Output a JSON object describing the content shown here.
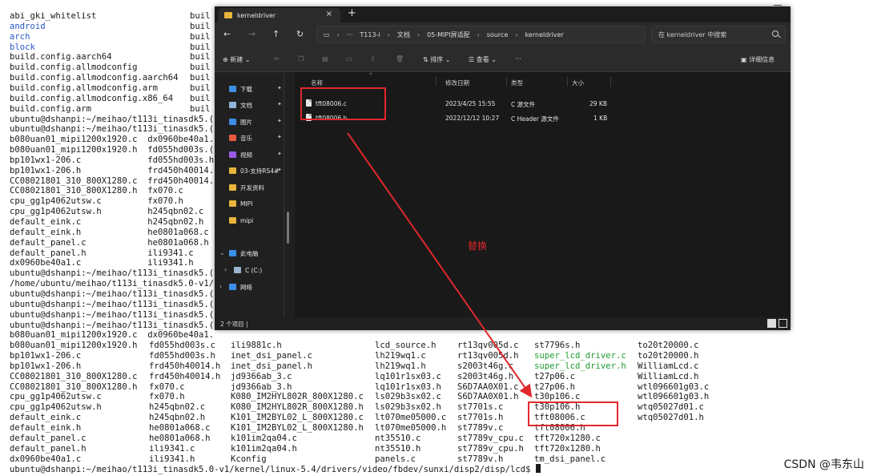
{
  "terminal": {
    "left_block": [
      {
        "c1": "abi_gki_whitelist",
        "c2": "buil",
        "cls": ""
      },
      {
        "c1": "android",
        "c2": "buil",
        "cls": "t-blue"
      },
      {
        "c1": "arch",
        "c2": "buil",
        "cls": "t-blue"
      },
      {
        "c1": "block",
        "c2": "buil",
        "cls": "t-blue"
      },
      {
        "c1": "build.config.aarch64",
        "c2": "buil",
        "cls": ""
      },
      {
        "c1": "build.config.allmodconfig",
        "c2": "buil",
        "cls": ""
      },
      {
        "c1": "build.config.allmodconfig.aarch64",
        "c2": "buil",
        "cls": ""
      },
      {
        "c1": "build.config.allmodconfig.arm",
        "c2": "buil",
        "cls": ""
      },
      {
        "c1": "build.config.allmodconfig.x86_64",
        "c2": "buil",
        "cls": ""
      },
      {
        "c1": "build.config.arm",
        "c2": "buil",
        "cls": ""
      },
      {
        "c1": "ubuntu@dshanpi:~/meihao/t113i_tinasdk5.(",
        "c2": "",
        "cls": ""
      },
      {
        "c1": "ubuntu@dshanpi:~/meihao/t113i_tinasdk5.(",
        "c2": "",
        "cls": ""
      },
      {
        "c1": "b080uan01_mipi1200x1920.c  dx0960be40a1.",
        "c2": "",
        "cls": ""
      },
      {
        "c1": "b080uan01_mipi1200x1920.h  fd055hd003s.(",
        "c2": "",
        "cls": ""
      },
      {
        "c1": "bp101wx1-206.c             fd055hd003s.h",
        "c2": "",
        "cls": ""
      },
      {
        "c1": "bp101wx1-206.h             frd450h40014.",
        "c2": "",
        "cls": ""
      },
      {
        "c1": "CC08021801_310_800X1280.c  frd450h40014.",
        "c2": "",
        "cls": ""
      },
      {
        "c1": "CC08021801_310_800X1280.h  fx070.c",
        "c2": "",
        "cls": ""
      },
      {
        "c1": "cpu_gg1p4062utsw.c         fx070.h",
        "c2": "",
        "cls": ""
      },
      {
        "c1": "cpu_gg1p4062utsw.h         h245qbn02.c",
        "c2": "",
        "cls": ""
      },
      {
        "c1": "default_eink.c             h245qbn02.h",
        "c2": "",
        "cls": ""
      },
      {
        "c1": "default_eink.h             he0801a068.c",
        "c2": "",
        "cls": ""
      },
      {
        "c1": "default_panel.c            he0801a068.h",
        "c2": "",
        "cls": ""
      },
      {
        "c1": "default_panel.h            ili9341.c",
        "c2": "",
        "cls": ""
      },
      {
        "c1": "dx0960be40a1.c             ili9341.h",
        "c2": "",
        "cls": ""
      },
      {
        "c1": "ubuntu@dshanpi:~/meihao/t113i_tinasdk5.(",
        "c2": "",
        "cls": ""
      },
      {
        "c1": "/home/ubuntu/meihao/t113i_tinasdk5.0-v1/",
        "c2": "",
        "cls": ""
      },
      {
        "c1": "ubuntu@dshanpi:~/meihao/t113i_tinasdk5.(",
        "c2": "",
        "cls": ""
      },
      {
        "c1": "ubuntu@dshanpi:~/meihao/t113i_tinasdk5.(",
        "c2": "",
        "cls": ""
      },
      {
        "c1": "ubuntu@dshanpi:~/meihao/t113i_tinasdk5.(",
        "c2": "",
        "cls": ""
      },
      {
        "c1": "ubuntu@dshanpi:~/meihao/t113i_tinasdk5.(",
        "c2": "",
        "cls": ""
      },
      {
        "c1": "b080uan01_mipi1200x1920.c  dx0960be40a1.",
        "c2": "",
        "cls": ""
      }
    ],
    "listing": {
      "col_a": [
        "b080uan01_mipi1200x1920.h",
        "bp101wx1-206.c",
        "bp101wx1-206.h",
        "CC08021801_310_800X1280.c",
        "CC08021801_310_800X1280.h",
        "cpu_gg1p4062utsw.c",
        "cpu_gg1p4062utsw.h",
        "default_eink.c",
        "default_eink.h",
        "default_panel.c",
        "default_panel.h",
        "dx0960be40a1.c"
      ],
      "col_b": [
        "fd055hd003s.c",
        "fd055hd003s.h",
        "frd450h40014.h",
        "frd450h40014.h",
        "fx070.c",
        "fx070.h",
        "h245qbn02.c",
        "h245qbn02.h",
        "he0801a068.c",
        "he0801a068.h",
        "ili9341.c",
        "ili9341.h"
      ],
      "col_c": [
        "ili9881c.h",
        "inet_dsi_panel.c",
        "inet_dsi_panel.h",
        "jd9366ab_3.c",
        "jd9366ab_3.h",
        "K080_IM2HYL802R_800X1280.c",
        "K080_IM2HYL802R_800X1280.h",
        "K101_IM2BYL02_L_800X1280.c",
        "K101_IM2BYL02_L_800X1280.h",
        "k101im2qa04.c",
        "k101im2qa04.h",
        "Kconfig"
      ],
      "col_d": [
        "lcd_source.h",
        "lh219wq1.c",
        "lh219wq1.h",
        "lq101r1sx03.c",
        "lq101r1sx03.h",
        "ls029b3sx02.c",
        "ls029b3sx02.h",
        "lt070me05000.c",
        "lt070me05000.h",
        "nt35510.c",
        "nt35510.h",
        "panels.c"
      ],
      "col_e": [
        "rt13qv005d.c",
        "rt13qv005d.h",
        "s2003t46g.c",
        "s2003t46g.h",
        "S6D7AA0X01.c",
        "S6D7AA0X01.h",
        "st7701s.c",
        "st7701s.h",
        "st7789v.c",
        "st7789v_cpu.c",
        "st7789v_cpu.h",
        "st7789v.h"
      ],
      "col_f": [
        "st7796s.h",
        "super_lcd_driver.c",
        "super_lcd_driver.h",
        "t27p06.c",
        "t27p06.h",
        "t30p106.c",
        "t30p106.h",
        "tft08006.c",
        "tft08006.h",
        "tft720x1280.c",
        "tft720x1280.h",
        "tm_dsi_panel.c"
      ],
      "col_g": [
        "to20t20000.c",
        "to20t20000.h",
        "WilliamLcd.c",
        "WilliamLcd.h",
        "wtl096601g03.c",
        "wtl096601g03.h",
        "wtq05027d01.c",
        "wtq05027d01.h",
        "",
        "",
        "",
        ""
      ]
    },
    "prompt": "ubuntu@dshanpi:~/meihao/t113i_tinasdk5.0-v1/kernel/linux-5.4/drivers/video/fbdev/sunxi/disp2/disp/lcd$ "
  },
  "explorer": {
    "tab_title": "kerneldriver",
    "tab_close": "×",
    "tab_new": "+",
    "nav": {
      "back": "←",
      "forward": "→",
      "up": "↑",
      "refresh": "↻"
    },
    "breadcrumbs": [
      "T113-i",
      "文档",
      "05-MIPI屏适配",
      "source",
      "kerneldriver"
    ],
    "crumb_sep": "›",
    "crumb_more": "···",
    "search_placeholder": "在 kerneldriver 中搜索",
    "toolbar": {
      "new": "⊕ 新建 ⌄",
      "cut": "✂",
      "copy": "❐",
      "paste": "▤",
      "rename": "▭",
      "share": "⇪",
      "delete": "🗑",
      "sort": "⇅ 排序 ⌄",
      "view": "☰ 查看 ⌄",
      "more": "···",
      "details": "详细信息"
    },
    "nav_pane": [
      {
        "label": "下载",
        "color": "#3d8ee6",
        "pin": true
      },
      {
        "label": "文档",
        "color": "#8fb3d9",
        "pin": true
      },
      {
        "label": "图片",
        "color": "#3d8ee6",
        "pin": true
      },
      {
        "label": "音乐",
        "color": "#e65a3d",
        "pin": true
      },
      {
        "label": "视频",
        "color": "#9a5ae6",
        "pin": true
      },
      {
        "label": "03-支持RS4#",
        "color": "#e8b53c",
        "pin": true
      },
      {
        "label": "开发资料",
        "color": "#e8b53c",
        "pin": false
      },
      {
        "label": "MIPI",
        "color": "#e8b53c",
        "pin": false
      },
      {
        "label": "mipi",
        "color": "#e8b53c",
        "pin": false
      },
      {
        "label": "此电脑",
        "color": "#3d8ee6",
        "pin": false
      },
      {
        "label": "C (C:)",
        "color": "#9ab5d0",
        "pin": false
      },
      {
        "label": "网络",
        "color": "#3d8ee6",
        "pin": false
      }
    ],
    "columns": {
      "name": "名称",
      "date": "修改日期",
      "type": "类型",
      "size": "大小"
    },
    "files": [
      {
        "name": "tft08006.c",
        "date": "2023/4/25 15:55",
        "type": "C 源文件",
        "size": "29 KB"
      },
      {
        "name": "tft08006.h",
        "date": "2022/12/12 10:27",
        "type": "C Header 源文件",
        "size": "1 KB"
      }
    ],
    "status": "2 个项目  |"
  },
  "annotation": {
    "label": "替换",
    "color": "#e0282c"
  },
  "watermark": "CSDN @韦东山"
}
